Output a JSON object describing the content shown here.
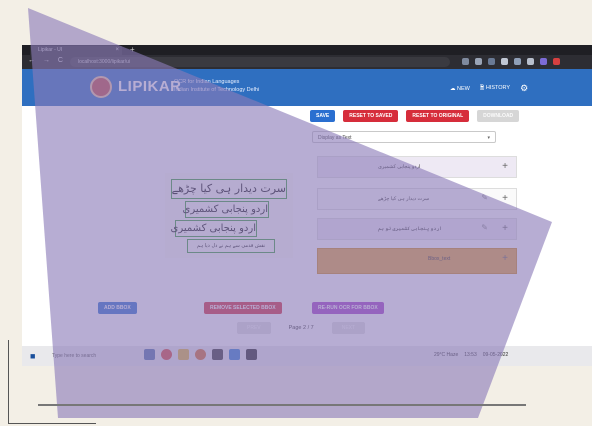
{
  "browser": {
    "tab_title": "Lipikar - UI",
    "tab_close": "×",
    "new_tab": "+",
    "nav_buttons": "← → C ⌂",
    "url": "localhost:3000/lipikar/ui"
  },
  "header": {
    "brand": "LIPIKAR",
    "subtitle_line1": "OCR for Indian Languages",
    "subtitle_line2": "Indian Institute of Technology Delhi",
    "new_label": "NEW",
    "history_label": "HISTORY",
    "settings_icon": "gear-icon"
  },
  "toolbar": {
    "save_label": "SAVE",
    "reset_saved_label": "RESET TO SAVED",
    "reset_original_label": "RESET TO ORIGINAL",
    "download_label": "DOWNLOAD"
  },
  "select": {
    "value": "Display as Text",
    "caret": "▾"
  },
  "rows": [
    {
      "text": "اردو پنجابی کشمیری",
      "plus": "+"
    },
    {
      "text": "سرت دیدار ہی کیا چڑھے",
      "pencil": "✎",
      "plus": "+"
    },
    {
      "text": "اردو پنجابی کشمیری تو ہم",
      "pencil": "✎",
      "plus": "+"
    },
    {
      "text": "Bbox_text",
      "plus": "+"
    }
  ],
  "document_lines": [
    "سرت دیدار ہی کیا چڑھے",
    "اردو پنجابی کشمیری",
    "اردو پنجابی کشمیری",
    "نقش قدمی سے ہم نے دل دیا ہم"
  ],
  "bottom": {
    "add_bbox_label": "ADD BBOX",
    "remove_bbox_label": "REMOVE SELECTED BBOX",
    "rerun_ocr_label": "RE-RUN OCR FOR BBOX",
    "prev_label": "PREV",
    "page_label": "Page 2 / 7",
    "next_label": "NEXT"
  },
  "taskbar": {
    "start_icon": "windows-icon",
    "search_placeholder": "Type here to search",
    "weather": "29°C Haze",
    "time": "13:53",
    "date": "09-05-2022"
  },
  "colors": {
    "header_blue": "#2f6fc0",
    "save_blue": "#2a6fd0",
    "reset_red": "#d62d3b",
    "rerun_purple": "#a63fc7",
    "highlight_orange": "#e8a53a",
    "overlay_purple": "#8a7ab8",
    "bbox_green": "#3aa13a"
  }
}
